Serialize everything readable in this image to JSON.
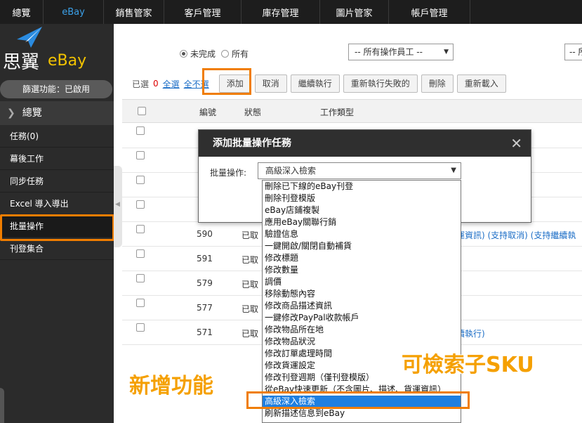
{
  "topnav": {
    "items": [
      {
        "label": "總覽",
        "active": false
      },
      {
        "label": "eBay",
        "active": true
      },
      {
        "label": "銷售管家",
        "active": false
      },
      {
        "label": "客戶管理",
        "active": false
      },
      {
        "label": "庫存管理",
        "active": false
      },
      {
        "label": "圖片管家",
        "active": false
      },
      {
        "label": "帳戶管理",
        "active": false
      }
    ]
  },
  "sidebar": {
    "brand": "思翼",
    "brand_en": "eBay",
    "filter_status": "篩選功能：已啟用",
    "overview": "總覽",
    "items": [
      {
        "label": "任務(0)"
      },
      {
        "label": "幕後工作"
      },
      {
        "label": "同步任務"
      },
      {
        "label": "Excel 導入導出"
      },
      {
        "label": "批量操作"
      },
      {
        "label": "刊登集合"
      }
    ]
  },
  "filters": {
    "radio_incomplete": "未完成",
    "radio_all": "所有",
    "employee_select": "-- 所有操作員工 --",
    "second_select": "-- 所"
  },
  "toolbar": {
    "selected_prefix": "已選",
    "selected_count": "0",
    "select_all": "全選",
    "select_none": "全不選",
    "buttons": [
      "添加",
      "取消",
      "繼續執行",
      "重新執行失敗的",
      "刪除",
      "重新載入"
    ]
  },
  "table": {
    "headers": [
      "編號",
      "狀態",
      "工作類型"
    ],
    "rows": [
      {
        "id": "",
        "status": "",
        "actions": ""
      },
      {
        "id": "",
        "status": "",
        "actions": ""
      },
      {
        "id": "",
        "status": "",
        "actions": ""
      },
      {
        "id": "",
        "status": "",
        "actions": ""
      },
      {
        "id": "590",
        "status": "已取",
        "actions": "運資訊)  (支持取消) (支持繼續執"
      },
      {
        "id": "591",
        "status": "已取",
        "actions": ""
      },
      {
        "id": "579",
        "status": "已取",
        "actions": ""
      },
      {
        "id": "577",
        "status": "已取",
        "actions": ""
      },
      {
        "id": "571",
        "status": "已取",
        "actions": "續執行)"
      }
    ]
  },
  "modal": {
    "title": "添加批量操作任務",
    "close_glyph": "✕",
    "field_label": "批量操作:",
    "selected_value": "高級深入檢索"
  },
  "dropdown": {
    "options": [
      "刪除已下線的eBay刊登",
      "刪除刊登模版",
      "eBay店鋪複製",
      "應用eBay關聯行銷",
      "驗證信息",
      "一鍵開啟/關閉自動補貨",
      "修改標題",
      "修改數量",
      "調價",
      "移除動態內容",
      "修改商品描述資訊",
      "一鍵修改PayPal收款帳戶",
      "修改物品所在地",
      "修改物品狀況",
      "修改訂單處理時間",
      "修改貨運設定",
      "修改刊登週期（僅刊登模版）",
      "從eBay快速更新（不含圖片、描述、貨運資訊）",
      "高級深入檢索",
      "刷新描述信息到eBay"
    ],
    "selected_index": 18
  },
  "annotations": {
    "new_feature": "新增功能",
    "sku_search": "可檢索子SKU"
  },
  "colors": {
    "highlight": "#f07d00",
    "annotation_text": "#f5a000",
    "nav_active": "#3ba0e8",
    "selection": "#1e7fe0"
  }
}
